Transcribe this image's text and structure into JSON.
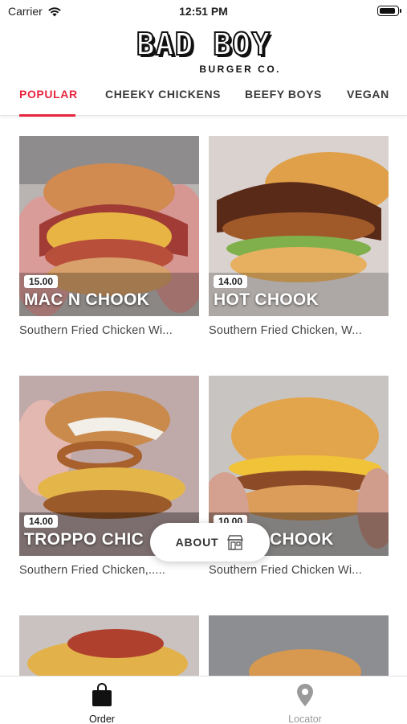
{
  "status": {
    "carrier": "Carrier",
    "time": "12:51 PM"
  },
  "logo": {
    "main": "BAD BOY",
    "sub": "BURGER CO."
  },
  "tabs": [
    {
      "label": "POPULAR",
      "active": true
    },
    {
      "label": "CHEEKY CHICKENS",
      "active": false
    },
    {
      "label": "BEEFY BOYS",
      "active": false
    },
    {
      "label": "VEGAN",
      "active": false
    }
  ],
  "products": [
    {
      "name": "MAC N CHOOK",
      "price": "15.00",
      "description": "Southern Fried Chicken Wi..."
    },
    {
      "name": "HOT CHOOK",
      "price": "14.00",
      "description": "Southern Fried Chicken, W..."
    },
    {
      "name": "TROPPO CHIC",
      "price": "14.00",
      "description": "Southern Fried Chicken,....."
    },
    {
      "name": "CHOOK",
      "price": "10.00",
      "description": "Southern Fried Chicken Wi..."
    }
  ],
  "about": {
    "label": "ABOUT"
  },
  "bottom_nav": [
    {
      "label": "Order",
      "active": true
    },
    {
      "label": "Locator",
      "active": false
    }
  ],
  "colors": {
    "accent": "#e8263f",
    "inactive": "#9a9a9a"
  },
  "icons": [
    "wifi-icon",
    "battery-icon",
    "store-icon",
    "shopping-bag-icon",
    "location-pin-icon"
  ]
}
